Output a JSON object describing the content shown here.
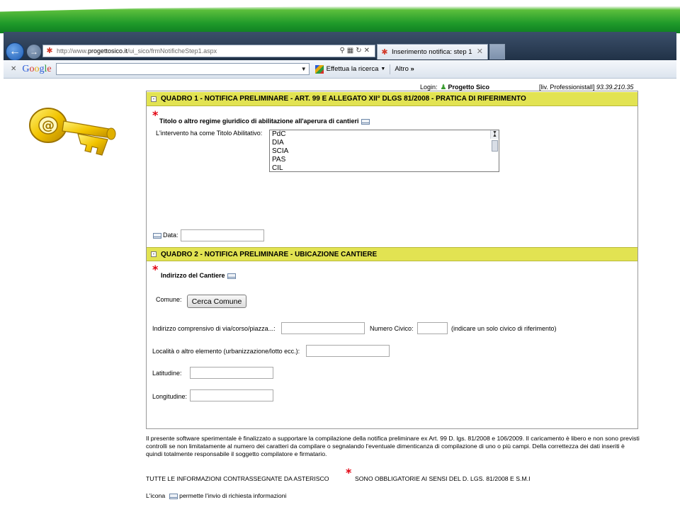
{
  "browser": {
    "url_prefix": "http://www.",
    "url_domain": "progettosico.it",
    "url_path": "/ui_sico/frmNotificheStep1.aspx",
    "tab_title": "Inserimento notifica: step 1",
    "toolbar": {
      "search_button": "Effettua la ricerca",
      "more_label": "Altro"
    }
  },
  "header": {
    "login_label": "Login:",
    "user_name": "Progetto Sico",
    "level_text": "[liv. Professionistall]",
    "ip": "93.39.210.35"
  },
  "quadro1": {
    "title": "QUADRO 1 - NOTIFICA PRELIMINARE - ART. 99 E ALLEGATO XII° DLGS 81/2008 - PRATICA DI RIFERIMENTO",
    "section_title": "Titolo o altro regime giuridico di abilitazione all'aperura di cantieri",
    "field_label": "L'intervento ha come Titolo Abilitativo:",
    "options": [
      "PdC",
      "DIA",
      "SCIA",
      "PAS",
      "CIL"
    ],
    "date_label": "Data:"
  },
  "quadro2": {
    "title": "QUADRO 2 - NOTIFICA PRELIMINARE - UBICAZIONE CANTIERE",
    "section_title": "Indirizzo del Cantiere",
    "comune_label": "Comune:",
    "search_button": "Cerca Comune",
    "address_label": "Indirizzo comprensivo di via/corso/piazza...:",
    "civic_label": "Numero Civico:",
    "civic_hint": "(indicare un solo civico di riferimento)",
    "locality_label": "Località o altro elemento (urbanizzazione/lotto ecc.):",
    "latitude_label": "Latitudine:",
    "longitude_label": "Longitudine:"
  },
  "footer": {
    "disclaimer": "Il presente software sperimentale è finalizzato a supportare la compilazione della notifica preliminare ex Art. 99 D. lgs. 81/2008 e 106/2009. Il caricamento è libero e non sono previsti controlli se non limitatamente al numero dei caratteri da compilare o segnalando l'eventuale dimenticanza di compilazione di uno o più campi. Della correttezza dei dati inseriti è quindi totalmente responsabile il soggetto compilatore e firmatario.",
    "mandatory_left": "TUTTE LE INFORMAZIONI CONTRASSEGNATE DA ASTERISCO",
    "mandatory_right": "SONO OBBLIGATORIE AI SENSI DEL D. LGS. 81/2008 E S.M.I",
    "icon_prefix": "L'icona",
    "icon_suffix": "permette l'invio di richiesta informazioni"
  }
}
